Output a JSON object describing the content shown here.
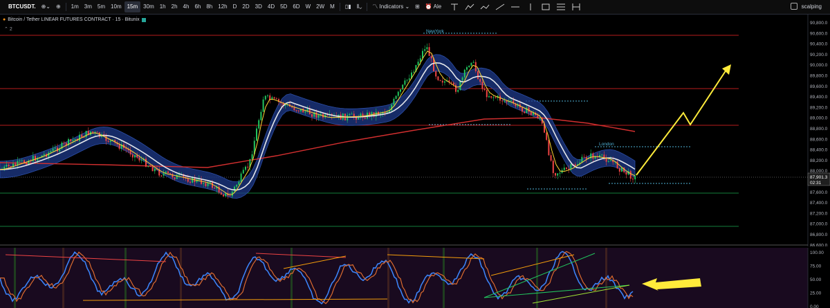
{
  "toolbar": {
    "symbol": "BTCUSDT.",
    "timeframes": [
      "1m",
      "3m",
      "5m",
      "10m",
      "15m",
      "30m",
      "1h",
      "2h",
      "4h",
      "6h",
      "8h",
      "12h",
      "D",
      "2D",
      "3D",
      "4D",
      "5D",
      "6D",
      "W",
      "2W",
      "M"
    ],
    "active_timeframe": "15m",
    "indicators_label": "Indicators",
    "alert_label": "Ale",
    "layout_name": "scalping"
  },
  "chart": {
    "title": "Bitcoin / Tether LINEAR FUTURES CONTRACT · 15 · Bitunix",
    "indicator_count": "2",
    "session_labels": {
      "newyork": "NewYork",
      "london": "London"
    },
    "price_axis": [
      "90,800.0",
      "90,600.0",
      "90,400.0",
      "90,200.0",
      "90,000.0",
      "89,800.0",
      "89,600.0",
      "89,400.0",
      "89,200.0",
      "89,000.0",
      "88,800.0",
      "88,600.0",
      "88,400.0",
      "88,200.0",
      "88,000.0",
      "87,800.0",
      "87,600.0",
      "87,400.0",
      "87,200.0",
      "87,000.0",
      "86,800.0",
      "86,600.0"
    ],
    "current_price": "87,901.3",
    "countdown": "02:31",
    "colors": {
      "up": "#22c55e",
      "down": "#ef4444",
      "ema_fast": "#fcd535",
      "ema_slow": "#d32f2f",
      "band": "#1e3a8a",
      "annotation": "#ffeb3b"
    }
  },
  "oscillator": {
    "levels": [
      "100.00",
      "75.00",
      "50.00",
      "25.00",
      "0.00"
    ]
  }
}
